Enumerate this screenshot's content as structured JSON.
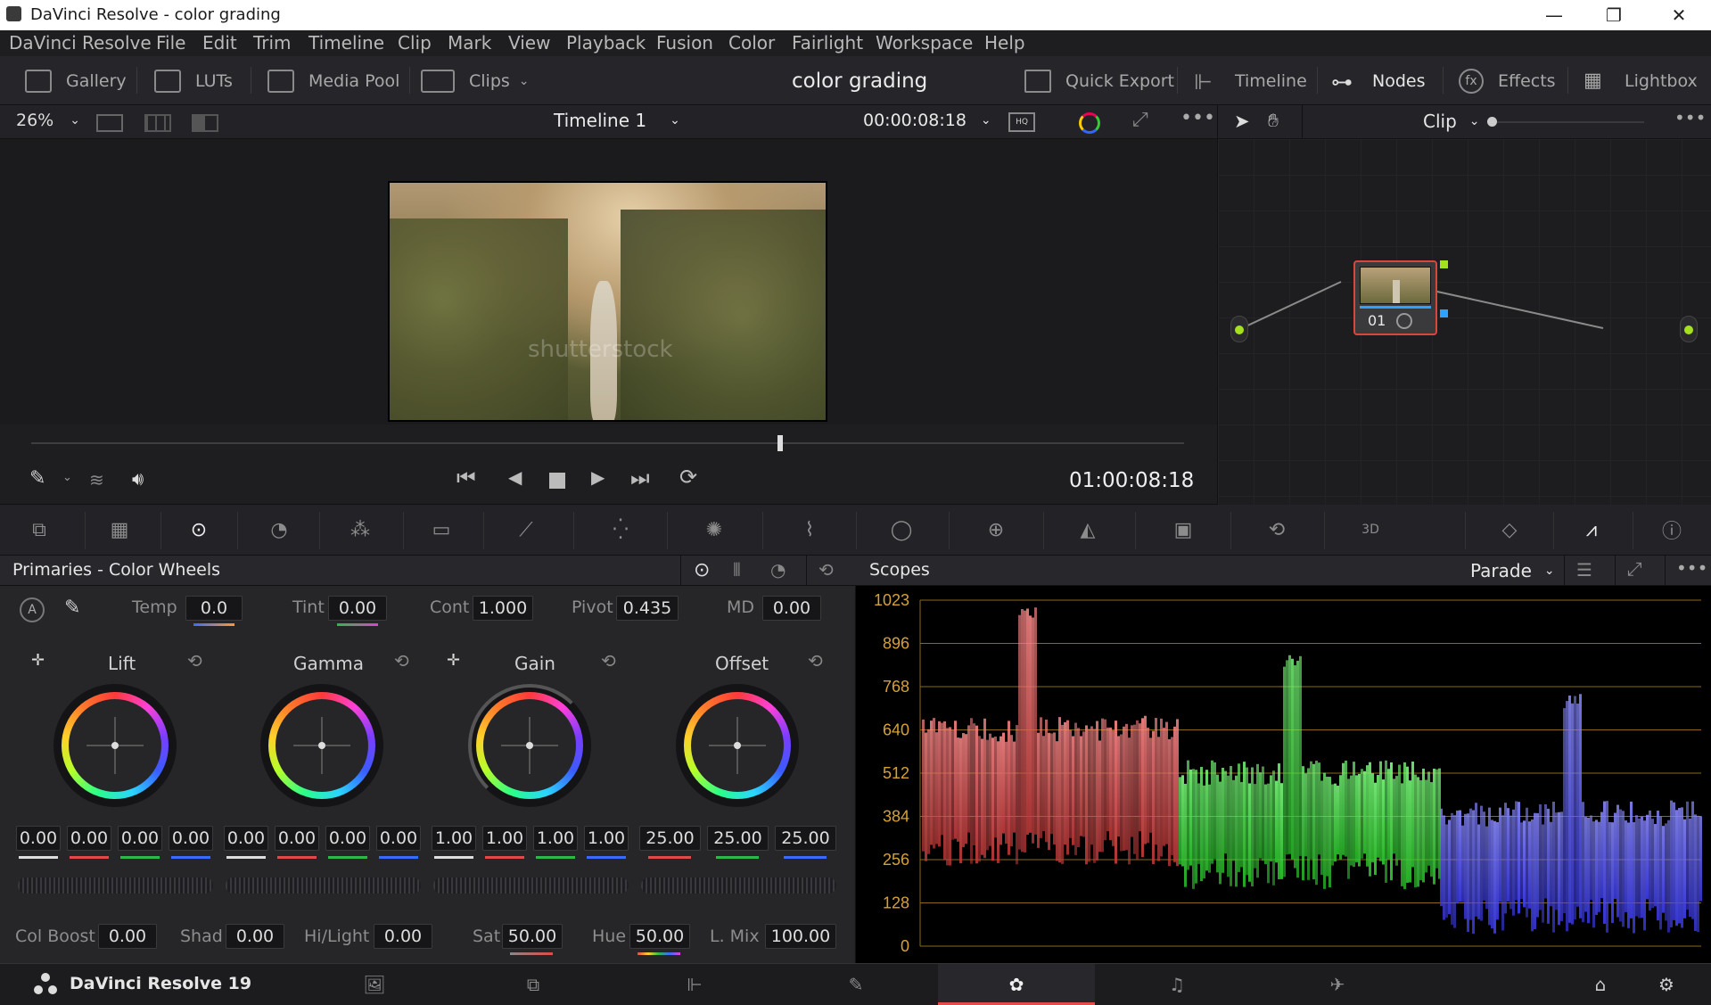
{
  "window": {
    "title": "DaVinci Resolve - color grading",
    "minimize": "—",
    "maximize": "❐",
    "close": "✕"
  },
  "menu": [
    "DaVinci Resolve",
    "File",
    "Edit",
    "Trim",
    "Timeline",
    "Clip",
    "Mark",
    "View",
    "Playback",
    "Fusion",
    "Color",
    "Fairlight",
    "Workspace",
    "Help"
  ],
  "toolbar": {
    "gallery": "Gallery",
    "luts": "LUTs",
    "media_pool": "Media Pool",
    "clips": "Clips",
    "project_title": "color grading",
    "quick_export": "Quick Export",
    "timeline": "Timeline",
    "nodes": "Nodes",
    "effects": "Effects",
    "lightbox": "Lightbox"
  },
  "viewer": {
    "zoom": "26%",
    "timeline_name": "Timeline 1",
    "timecode_top": "00:00:08:18",
    "timecode": "01:00:08:18",
    "watermark": "shutterstock",
    "playhead_fraction": 0.65
  },
  "nodes": {
    "mode": "Clip",
    "node_label": "01"
  },
  "primaries": {
    "title": "Primaries - Color Wheels",
    "temp_label": "Temp",
    "temp": "0.0",
    "tint_label": "Tint",
    "tint": "0.00",
    "cont_label": "Cont",
    "cont": "1.000",
    "pivot_label": "Pivot",
    "pivot": "0.435",
    "md_label": "MD",
    "md": "0.00",
    "wheels": [
      {
        "name": "Lift",
        "values": [
          "0.00",
          "0.00",
          "0.00",
          "0.00"
        ]
      },
      {
        "name": "Gamma",
        "values": [
          "0.00",
          "0.00",
          "0.00",
          "0.00"
        ]
      },
      {
        "name": "Gain",
        "values": [
          "1.00",
          "1.00",
          "1.00",
          "1.00"
        ]
      },
      {
        "name": "Offset",
        "values": [
          "25.00",
          "25.00",
          "25.00"
        ]
      }
    ],
    "col_boost_label": "Col Boost",
    "col_boost": "0.00",
    "shad_label": "Shad",
    "shad": "0.00",
    "hilight_label": "Hi/Light",
    "hilight": "0.00",
    "sat_label": "Sat",
    "sat": "50.00",
    "hue_label": "Hue",
    "hue": "50.00",
    "lmix_label": "L. Mix",
    "lmix": "100.00"
  },
  "scopes": {
    "title": "Scopes",
    "mode": "Parade",
    "ticks": [
      "1023",
      "896",
      "768",
      "640",
      "512",
      "384",
      "256",
      "128",
      "0"
    ]
  },
  "footer": {
    "app_name": "DaVinci Resolve 19"
  },
  "colors": {
    "accent": "#e64a4a",
    "red": "#e14a4a",
    "green": "#2fb84a",
    "blue": "#3a6bff",
    "node_border": "#d9473b",
    "scope_grid": "#8a6a1a"
  }
}
